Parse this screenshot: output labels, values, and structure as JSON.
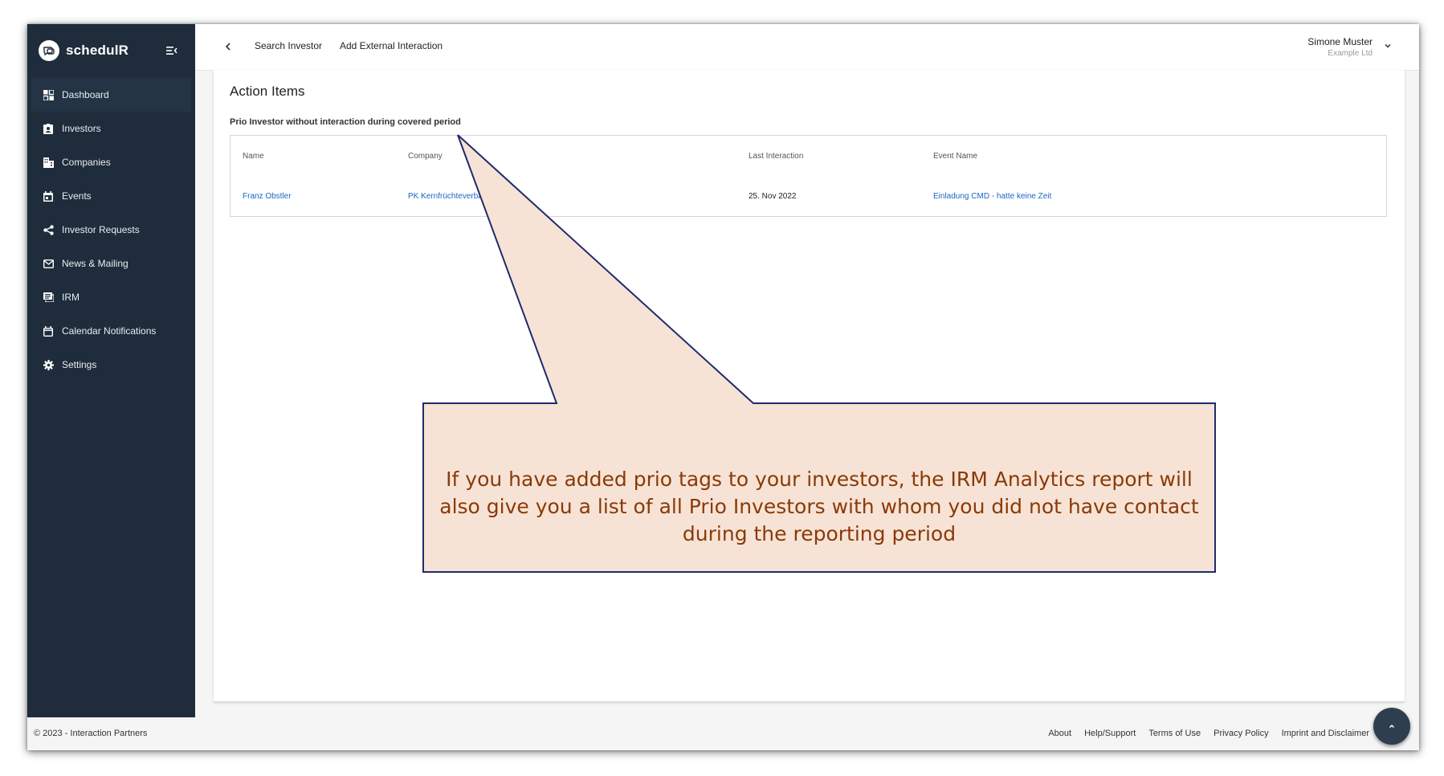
{
  "app": {
    "name": "schedulR"
  },
  "sidebar": {
    "items": [
      {
        "label": "Dashboard",
        "icon": "dashboard-icon"
      },
      {
        "label": "Investors",
        "icon": "investor-badge-icon"
      },
      {
        "label": "Companies",
        "icon": "building-icon"
      },
      {
        "label": "Events",
        "icon": "calendar-icon"
      },
      {
        "label": "Investor Requests",
        "icon": "share-icon"
      },
      {
        "label": "News & Mailing",
        "icon": "mail-icon"
      },
      {
        "label": "IRM",
        "icon": "report-icon"
      },
      {
        "label": "Calendar Notifications",
        "icon": "calendar-notification-icon"
      },
      {
        "label": "Settings",
        "icon": "gear-icon"
      }
    ]
  },
  "topbar": {
    "links": [
      "Search Investor",
      "Add External Interaction"
    ],
    "user": {
      "name": "Simone Muster",
      "company": "Example Ltd"
    }
  },
  "main": {
    "section_title": "Action Items",
    "subtitle": "Prio Investor without interaction during covered period",
    "table": {
      "headers": [
        "Name",
        "Company",
        "Last Interaction",
        "Event Name"
      ],
      "rows": [
        {
          "name": "Franz Obstler",
          "company": "PK Kernfrüchteverband",
          "last_interaction": "25. Nov 2022",
          "event": "Einladung CMD - hatte keine Zeit"
        }
      ]
    }
  },
  "footer": {
    "copyright": "© 2023 - Interaction Partners",
    "links": [
      "About",
      "Help/Support",
      "Terms of Use",
      "Privacy Policy",
      "Imprint and Disclaimer"
    ]
  },
  "callout": {
    "text": "If you have added prio tags to your investors, the IRM Analytics report will also give you a list of all Prio Investors with whom you did not have contact during the reporting period",
    "fill": "#f7e3d6",
    "border": "#1f2b6b",
    "text_color": "#8a3a06"
  }
}
